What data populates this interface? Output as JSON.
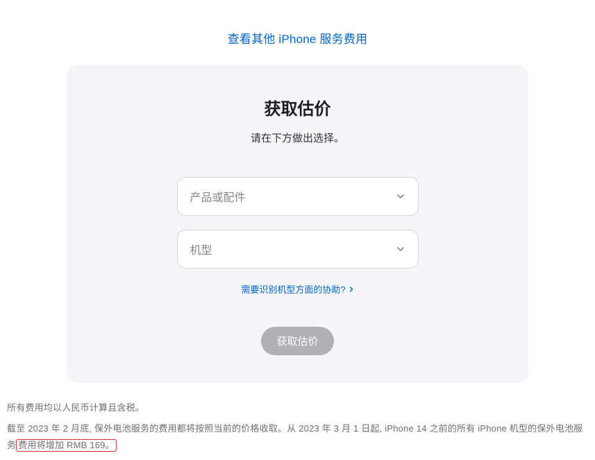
{
  "top_link": {
    "label": "查看其他 iPhone 服务费用"
  },
  "card": {
    "title": "获取估价",
    "subtitle": "请在下方做出选择。",
    "select_product_placeholder": "产品或配件",
    "select_model_placeholder": "机型",
    "help_link_label": "需要识别机型方面的协助?",
    "cta_label": "获取估价"
  },
  "footnote1": "所有费用均以人民币计算且含税。",
  "footnote2_a": "截至 2023 年 2 月底, 保外电池服务的费用都将按照当前的价格收取。从 2023 年 3 月 1 日起, iPhone 14 之前的所有 iPhone 机型的保外电池服务",
  "footnote2_b": "费用将增加 RMB 169。"
}
